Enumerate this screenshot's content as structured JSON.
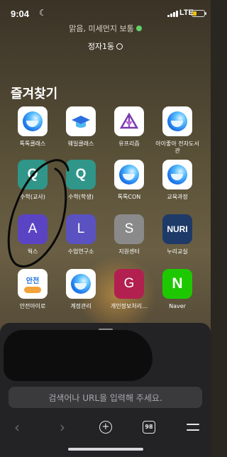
{
  "status_bar": {
    "time": "9:04",
    "network": "LTE",
    "battery_level": 0.3,
    "battery_color": "#f4c400"
  },
  "header": {
    "status_text": "맑음, 미세먼지 보통",
    "location": "정자1동"
  },
  "favorites": {
    "title": "즐겨찾기",
    "items": [
      {
        "label": "톡톡클래스",
        "icon": "swirl-icon"
      },
      {
        "label": "웨일클래스",
        "icon": "graduation-cap-icon"
      },
      {
        "label": "유프리즘",
        "icon": "prism-icon"
      },
      {
        "label": "아이좋아 전자도서관",
        "icon": "swirl-icon"
      },
      {
        "label": "수학(교사)",
        "icon": "q-icon",
        "letter": "Q"
      },
      {
        "label": "수학(학생)",
        "icon": "q-icon",
        "letter": "Q"
      },
      {
        "label": "톡톡CON",
        "icon": "swirl-icon"
      },
      {
        "label": "교육과정",
        "icon": "swirl-icon"
      },
      {
        "label": "웍스",
        "icon": "a-icon",
        "letter": "A"
      },
      {
        "label": "수업연구소",
        "icon": "l-icon",
        "letter": "L"
      },
      {
        "label": "지원센터",
        "icon": "s-icon",
        "letter": "S"
      },
      {
        "label": "누리교실",
        "icon": "nuri-icon",
        "letter": "NURI"
      },
      {
        "label": "안전아이로",
        "icon": "safety-icon",
        "letter": "안전"
      },
      {
        "label": "계정관리",
        "icon": "swirl-icon"
      },
      {
        "label": "개인정보처리…",
        "icon": "g-icon",
        "letter": "G"
      },
      {
        "label": "Naver",
        "icon": "naver-icon",
        "letter": "N"
      }
    ]
  },
  "browser": {
    "url_placeholder": "검색어나 URL을 입력해 주세요.",
    "tab_count": "98"
  }
}
